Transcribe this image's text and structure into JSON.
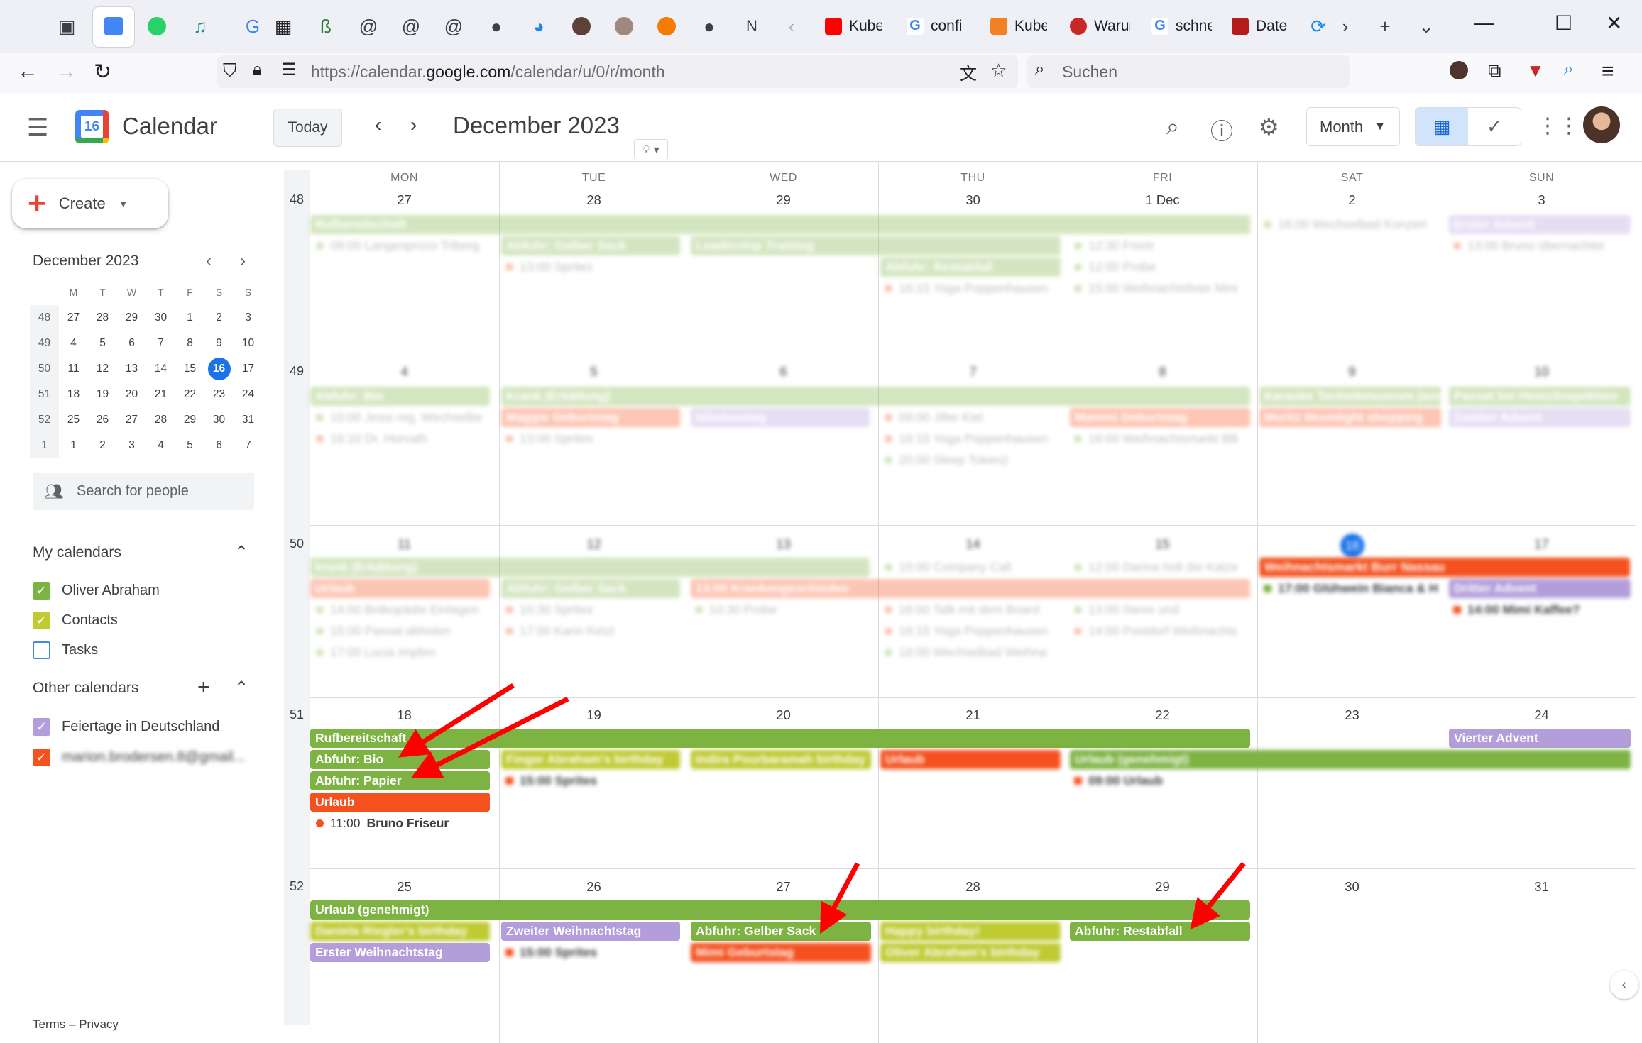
{
  "browser": {
    "url_prefix": "https://calendar.",
    "url_domain": "google.com",
    "url_path": "/calendar/u/0/r/month",
    "search_placeholder": "Suchen",
    "tabs": [
      "Kuber",
      "config",
      "Kuber",
      "Warun",
      "schnel",
      "Dateie"
    ]
  },
  "header": {
    "app_title": "Calendar",
    "logo_day": "16",
    "today_label": "Today",
    "month_title": "December 2023",
    "view_label": "Month"
  },
  "sidebar": {
    "create_label": "Create",
    "mini_title": "December 2023",
    "mini_days": [
      "M",
      "T",
      "W",
      "T",
      "F",
      "S",
      "S"
    ],
    "mini_weeks": [
      {
        "wk": "48",
        "days": [
          "27",
          "28",
          "29",
          "30",
          "1",
          "2",
          "3"
        ]
      },
      {
        "wk": "49",
        "days": [
          "4",
          "5",
          "6",
          "7",
          "8",
          "9",
          "10"
        ]
      },
      {
        "wk": "50",
        "days": [
          "11",
          "12",
          "13",
          "14",
          "15",
          "16",
          "17"
        ]
      },
      {
        "wk": "51",
        "days": [
          "18",
          "19",
          "20",
          "21",
          "22",
          "23",
          "24"
        ]
      },
      {
        "wk": "52",
        "days": [
          "25",
          "26",
          "27",
          "28",
          "29",
          "30",
          "31"
        ]
      },
      {
        "wk": "1",
        "days": [
          "1",
          "2",
          "3",
          "4",
          "5",
          "6",
          "7"
        ]
      }
    ],
    "search_people": "Search for people",
    "my_calendars_title": "My calendars",
    "my_calendars": [
      {
        "name": "Oliver Abraham",
        "color": "#33b679",
        "checked": true
      },
      {
        "name": "Contacts",
        "color": "#c0ca33",
        "checked": true
      },
      {
        "name": "Tasks",
        "color": "#4285f4",
        "checked": false
      }
    ],
    "other_calendars_title": "Other calendars",
    "other_calendars": [
      {
        "name": "Feiertage in Deutschland",
        "color": "#b39ddb",
        "checked": true
      },
      {
        "name": "marion.brodersen.8@gmail...",
        "color": "#f4511e",
        "checked": true
      }
    ],
    "footer": {
      "terms": "Terms",
      "sep": " – ",
      "privacy": "Privacy"
    }
  },
  "grid": {
    "dow": [
      "MON",
      "TUE",
      "WED",
      "THU",
      "FRI",
      "SAT",
      "SUN"
    ],
    "weeks": [
      {
        "wk": "48",
        "days": [
          "27",
          "28",
          "29",
          "30",
          "1 Dec",
          "2",
          "3"
        ]
      },
      {
        "wk": "49",
        "days": [
          "4",
          "5",
          "6",
          "7",
          "8",
          "9",
          "10"
        ]
      },
      {
        "wk": "50",
        "days": [
          "11",
          "12",
          "13",
          "14",
          "15",
          "16",
          "17"
        ]
      },
      {
        "wk": "51",
        "days": [
          "18",
          "19",
          "20",
          "21",
          "22",
          "23",
          "24"
        ]
      },
      {
        "wk": "52",
        "days": [
          "25",
          "26",
          "27",
          "28",
          "29",
          "30",
          "31"
        ]
      }
    ]
  },
  "events": {
    "w48_bar1": "Rufbereitschaft",
    "w48_t1": "08:00 Langenprozo Triberg",
    "w48_b2": "Abfuhr: Gelber Sack",
    "w48_b3": "Leadership Training",
    "w48_b4": "Abfuhr: Restabfall",
    "w48_t2": "13:00 Sprites",
    "w48_t3": "16:15 Yoga Poppenhausen",
    "w48_t4": "12:30 Frisör",
    "w48_t5": "12:00 Probe",
    "w48_t6": "15:00 Weihnachtsfeier Mini",
    "w48_t7": "16:00 Wechselbad Konzert",
    "w48_b5": "Erster Advent",
    "w48_t8": "13:00 Bruno übernachtet",
    "w49_b1": "Abfuhr: Bio",
    "w49_b2": "Krank (Erkältung)",
    "w49_b3": "Karaoke Technikmuseum (aus",
    "w49_b4": "Passat bei Heinz/Inspektion",
    "w49_t1": "10:00 Jessi reg. Wechselbe",
    "w49_b5": "Maggie Geburtstag",
    "w49_b6": "Nikolaustag",
    "w49_t2": "09:00 Jiller Kiel",
    "w49_b7": "Mammi Geburtstag",
    "w49_b8": "Moritz Moonlight shopping",
    "w49_b9": "Zweiter Advent",
    "w49_t3": "16:10 Dr. Horvath",
    "w49_t4": "13:00 Sprites",
    "w49_t5": "16:15 Yoga Poppenhausen",
    "w49_t6": "16:00 Weihnachtsmarkt BB",
    "w49_t7": "20:00 Sleep Token2",
    "w50_b1": "krank (Erkältung)",
    "w50_t1": "15:00 Company Call",
    "w50_t2": "12:00 Darina holt die Katze",
    "w50_b2": "Weihnachtsmarkt Burr Nassau",
    "w50_b3": "Urlaub",
    "w50_b4": "Abfuhr: Gelber Sack",
    "w50_b5": "13:00 Krankengeschieden",
    "w50_t3": "17:00 Glühwein Bianca & H",
    "w50_b6": "Dritter Advent",
    "w50_t4": "14:00 Britkopädie Einlagen",
    "w50_t5": "10:30 Sprites",
    "w50_t6": "10:30 Probe",
    "w50_t7": "16:00 Talk mit dem Board",
    "w50_t8": "13:00 Steve und",
    "w50_t9": "14:00 Mimi Kaffee?",
    "w50_t10": "15:00 Passat abholen",
    "w50_t11": "17:00 Karin Ketzl",
    "w50_t12": "16:15 Yoga Poppenhausen",
    "w50_t13": "14:00 Postdorf Weihnachts",
    "w50_t14": "17:00 Lucia Impfen",
    "w50_t15": "18:00 Wechselbad Weihna",
    "w51_b1": "Rufbereitschaft",
    "w51_b2": "Vierter Advent",
    "w51_b3": "Abfuhr: Bio",
    "w51_b4": "Finger Abraham's birthday",
    "w51_b5": "Indira Pourbaramah birthday",
    "w51_b6": "Urlaub",
    "w51_b7": "Urlaub (genehmigt)",
    "w51_b8": "Abfuhr: Papier",
    "w51_t1": "15:00 Sprites",
    "w51_t2": "09:00 Urlaub",
    "w51_b9": "Urlaub",
    "w51_t3_time": "11:00",
    "w51_t3_title": "Bruno Friseur",
    "w52_b1": "Urlaub (genehmigt)",
    "w52_b2": "Daniela Riegler's birthday",
    "w52_b3": "Zweiter Weihnachtstag",
    "w52_b4": "Abfuhr: Gelber Sack",
    "w52_b5": "Happy birthday!",
    "w52_b6": "Abfuhr: Restabfall",
    "w52_b7": "Erster Weihnachtstag",
    "w52_t1": "15:00 Sprites",
    "w52_b8": "Mimi Geburtstag",
    "w52_b9": "Oliver Abraham's birthday"
  },
  "colors": {
    "green": "#7cb342",
    "tomato": "#f4511e",
    "lavender": "#b39ddb",
    "citron": "#c0ca33",
    "flamingo": "#e67c73",
    "accent": "#1a73e8",
    "annotation_arrow": "#ff0000"
  }
}
